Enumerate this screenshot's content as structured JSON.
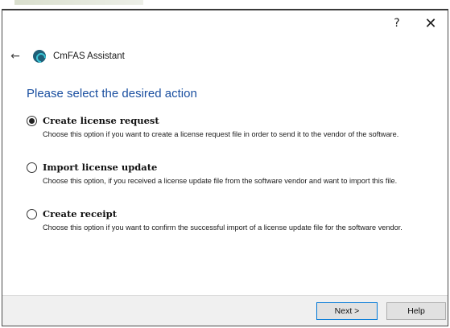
{
  "window": {
    "help_glyph": "?",
    "close_glyph": "✕"
  },
  "nav": {
    "back_glyph": "←",
    "app_title": "CmFAS Assistant"
  },
  "main": {
    "heading": "Please select the desired action",
    "options": [
      {
        "label": "Create license request",
        "description": "Choose this option if you want to create a license request file in order to send it to the vendor of the software.",
        "selected": true
      },
      {
        "label": "Import license update",
        "description": "Choose this option, if you received a license update file from the software vendor and want to import this file.",
        "selected": false
      },
      {
        "label": "Create receipt",
        "description": "Choose this option if you want to confirm the successful import of a license update file for the software vendor.",
        "selected": false
      }
    ]
  },
  "footer": {
    "next_label": "Next >",
    "help_label": "Help"
  }
}
